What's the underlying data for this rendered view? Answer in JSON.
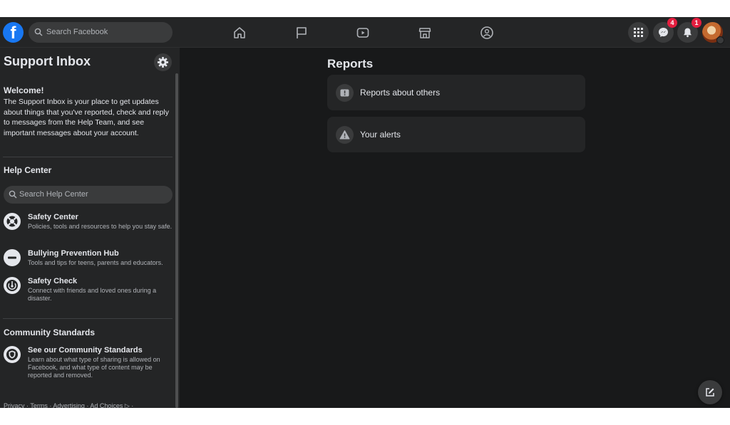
{
  "topbar": {
    "logo_letter": "f",
    "search_placeholder": "Search Facebook",
    "nav_icons": [
      "home-icon",
      "flag-icon",
      "watch-icon",
      "marketplace-icon",
      "groups-icon"
    ],
    "menu_icon": "grid-menu-icon",
    "messenger_badge": "4",
    "notifications_badge": "1"
  },
  "sidebar": {
    "title": "Support Inbox",
    "welcome_heading": "Welcome!",
    "welcome_text": "The Support Inbox is your place to get updates about things that you've reported, check and reply to messages from the Help Team, and see important messages about your account.",
    "help_center_heading": "Help Center",
    "help_search_placeholder": "Search Help Center",
    "help_items": [
      {
        "title": "Safety Center",
        "desc": "Policies, tools and resources to help you stay safe.",
        "icon": "lifebuoy-icon"
      },
      {
        "title": "Bullying Prevention Hub",
        "desc": "Tools and tips for teens, parents and educators.",
        "icon": "minus-circle-icon"
      },
      {
        "title": "Safety Check",
        "desc": "Connect with friends and loved ones during a disaster.",
        "icon": "safety-check-icon"
      }
    ],
    "community_heading": "Community Standards",
    "community_item": {
      "title": "See our Community Standards",
      "desc": "Learn about what type of sharing is allowed on Facebook, and what type of content may be reported and removed.",
      "icon": "shield-icon"
    },
    "footer": "Privacy · Terms · Advertising · Ad Choices ▷ ·"
  },
  "main": {
    "title": "Reports",
    "cards": [
      {
        "label": "Reports about others",
        "icon": "report-icon"
      },
      {
        "label": "Your alerts",
        "icon": "warning-icon"
      }
    ]
  },
  "colors": {
    "background": "#18191a",
    "surface": "#242526",
    "control": "#3a3b3c",
    "text_primary": "#e4e6eb",
    "text_secondary": "#b0b3b8",
    "brand": "#1877f2",
    "badge": "#e41e3f"
  }
}
